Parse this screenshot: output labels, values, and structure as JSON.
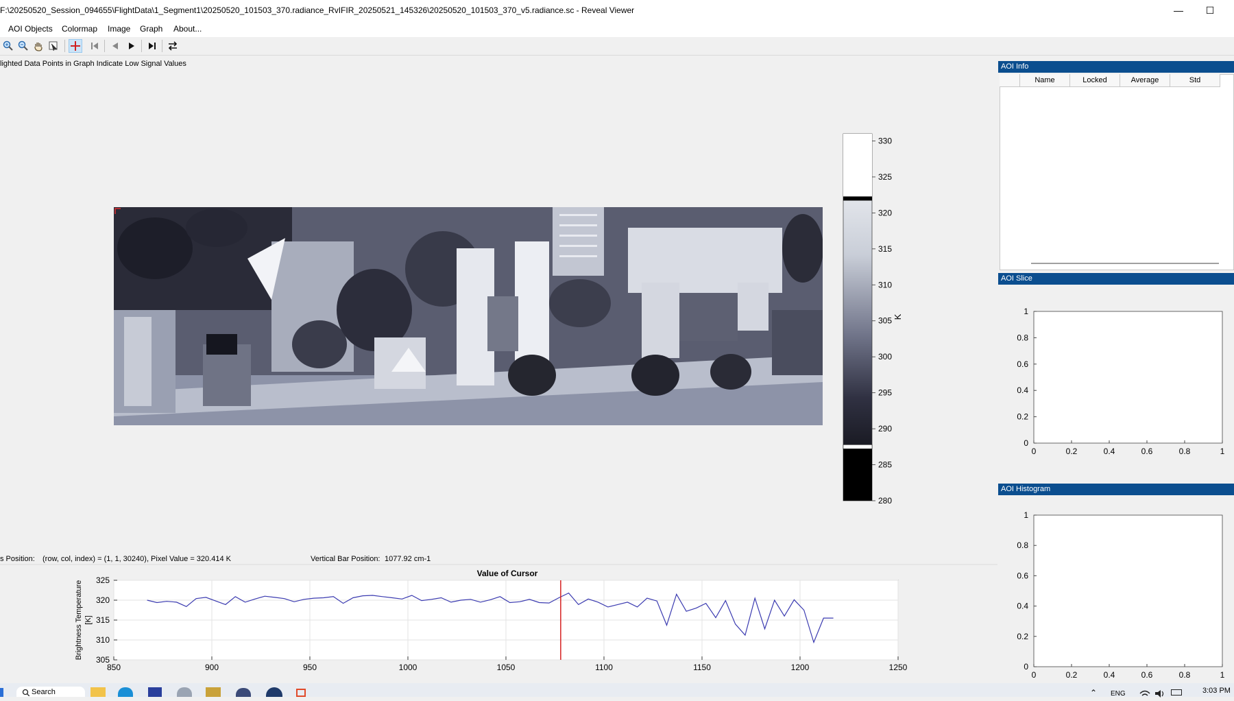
{
  "window": {
    "title": "F:\\20250520_Session_094655\\FlightData\\1_Segment1\\20250520_101503_370.radiance_RvIFIR_20250521_145326\\20250520_101503_370_v5.radiance.sc - Reveal Viewer",
    "minimize": "—",
    "maximize": "☐"
  },
  "menu": {
    "aoi_objects": "AOI Objects",
    "colormap": "Colormap",
    "image": "Image",
    "graph": "Graph",
    "about": "About..."
  },
  "toolbar": {
    "icons": [
      "zoom-in-icon",
      "zoom-out-icon",
      "pan-hand-icon",
      "data-cursor-icon",
      "crosshair-icon",
      "first-frame-icon",
      "previous-frame-icon",
      "next-frame-icon",
      "last-frame-icon",
      "swap-icon"
    ],
    "crosshair_selected": true
  },
  "hint": "lighted Data Points in Graph Indicate Low Signal Values",
  "colorbar": {
    "ticks": [
      "330",
      "325",
      "320",
      "315",
      "310",
      "305",
      "300",
      "295",
      "290",
      "285",
      "280"
    ],
    "unit": "K",
    "min": 280,
    "max": 331,
    "upper_marker": 322,
    "lower_marker": 287.5
  },
  "status": {
    "cursor_label": "s Position:",
    "cursor_value": "(row, col, index) = (1, 1, 30240), Pixel Value = 320.414 K",
    "vbar_label": "Vertical Bar Position:",
    "vbar_value": "1077.92 cm-1"
  },
  "panels": {
    "aoi_info": {
      "title": "AOI Info",
      "columns": [
        "Name",
        "Locked",
        "Average",
        "Std"
      ]
    },
    "aoi_slice": {
      "title": "AOI Slice",
      "yticks": [
        "1",
        "0.8",
        "0.6",
        "0.4",
        "0.2",
        "0"
      ],
      "xticks": [
        "0",
        "0.2",
        "0.4",
        "0.6",
        "0.8",
        "1"
      ]
    },
    "aoi_histogram": {
      "title": "AOI Histogram",
      "yticks": [
        "1",
        "0.8",
        "0.6",
        "0.4",
        "0.2",
        "0"
      ],
      "xticks": [
        "0",
        "0.2",
        "0.4",
        "0.6",
        "0.8",
        "1"
      ]
    }
  },
  "taskbar": {
    "search": "Search",
    "lang": "ENG",
    "time": "3:03 PM"
  },
  "chart_data": {
    "type": "line",
    "title": "Value of Cursor",
    "ylabel_line1": "Brightness Temperature",
    "ylabel_line2": "[K]",
    "xlim": [
      850,
      1250
    ],
    "ylim": [
      305,
      325
    ],
    "xticks": [
      "850",
      "900",
      "950",
      "1000",
      "1050",
      "1100",
      "1150",
      "1200",
      "1250"
    ],
    "yticks": [
      "325",
      "320",
      "315",
      "310",
      "305"
    ],
    "grid": true,
    "cursor_x": 1077.92,
    "series": [
      {
        "color": "#3a3ab0",
        "x": [
          867,
          872,
          877,
          882,
          887,
          892,
          897,
          902,
          907,
          912,
          917,
          922,
          927,
          932,
          937,
          942,
          947,
          952,
          957,
          962,
          967,
          972,
          977,
          982,
          987,
          992,
          997,
          1002,
          1007,
          1012,
          1017,
          1022,
          1027,
          1032,
          1037,
          1042,
          1047,
          1052,
          1057,
          1062,
          1067,
          1072,
          1077,
          1082,
          1087,
          1092,
          1097,
          1102,
          1107,
          1112,
          1117,
          1122,
          1127,
          1132,
          1137,
          1142,
          1147,
          1152,
          1157,
          1162,
          1167,
          1172,
          1177,
          1182,
          1187,
          1192,
          1197,
          1202,
          1207,
          1212,
          1217
        ],
        "y": [
          320.0,
          319.4,
          319.7,
          319.5,
          318.4,
          320.4,
          320.7,
          319.8,
          318.9,
          320.9,
          319.5,
          320.3,
          321.0,
          320.7,
          320.4,
          319.6,
          320.2,
          320.5,
          320.6,
          320.9,
          319.2,
          320.6,
          321.1,
          321.2,
          320.9,
          320.6,
          320.3,
          321.2,
          319.9,
          320.2,
          320.6,
          319.5,
          320.0,
          320.2,
          319.5,
          320.1,
          320.9,
          319.4,
          319.6,
          320.2,
          319.4,
          319.3,
          320.6,
          321.8,
          318.9,
          320.3,
          319.5,
          318.3,
          318.9,
          319.5,
          318.3,
          320.5,
          319.8,
          313.7,
          321.5,
          317.2,
          318.0,
          319.2,
          315.6,
          319.9,
          314.0,
          311.2,
          320.5,
          312.8,
          320.0,
          316.0,
          320.1,
          317.5,
          309.4,
          315.5,
          315.5
        ]
      }
    ]
  }
}
